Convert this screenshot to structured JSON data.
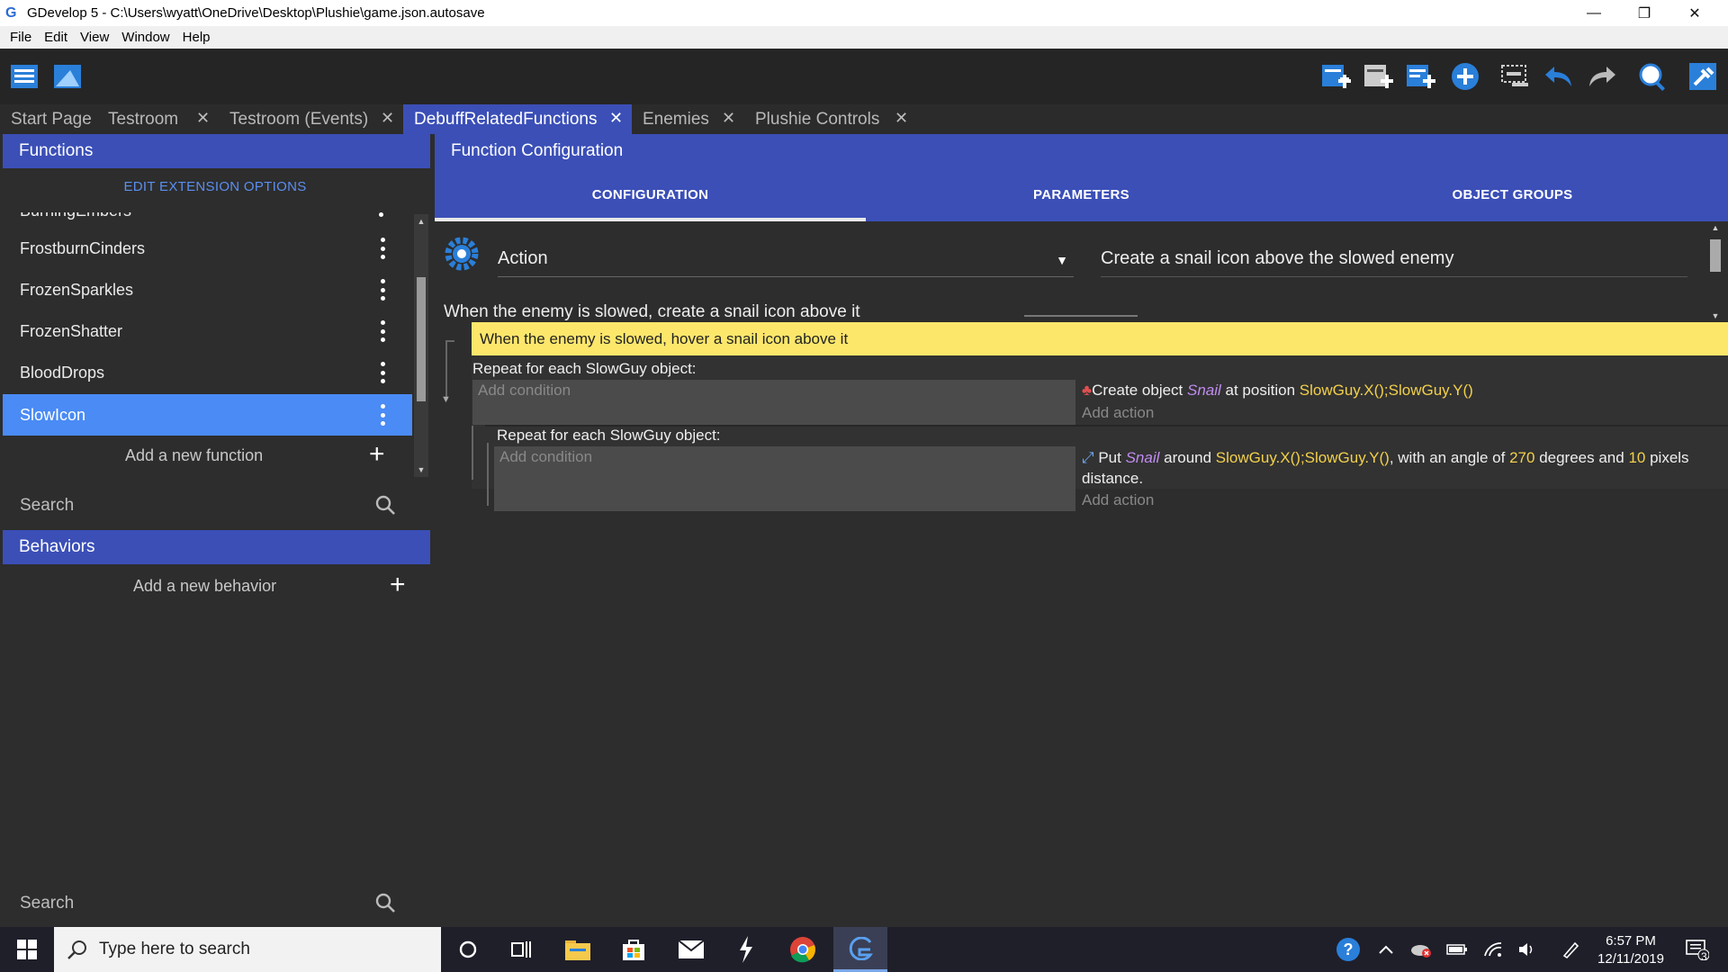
{
  "window": {
    "title": "GDevelop 5 - C:\\Users\\wyatt\\OneDrive\\Desktop\\Plushie\\game.json.autosave",
    "controls": {
      "minimize": "—",
      "restore": "❐",
      "close": "✕"
    }
  },
  "menu": [
    "File",
    "Edit",
    "View",
    "Window",
    "Help"
  ],
  "toolbar": {
    "left_icons": [
      "project-manager-icon",
      "scene-preview-icon"
    ],
    "right_icons": [
      "add-event-icon",
      "add-sub-event-icon",
      "add-comment-icon",
      "add-other-icon",
      "delete-selection-icon",
      "undo-icon",
      "redo-icon",
      "search-events-icon",
      "settings-icon"
    ]
  },
  "tabs": [
    {
      "label": "Start Page",
      "closable": false,
      "active": false
    },
    {
      "label": "Testroom",
      "closable": true,
      "active": false
    },
    {
      "label": "Testroom (Events)",
      "closable": true,
      "active": false
    },
    {
      "label": "DebuffRelatedFunctions",
      "closable": true,
      "active": true
    },
    {
      "label": "Enemies",
      "closable": true,
      "active": false
    },
    {
      "label": "Plushie Controls",
      "closable": true,
      "active": false
    }
  ],
  "functions_panel": {
    "header": "Functions",
    "edit_options": "EDIT EXTENSION OPTIONS",
    "partial_item": "BurningEmbers",
    "items": [
      "FrostburnCinders",
      "FrozenSparkles",
      "FrozenShatter",
      "BloodDrops",
      "SlowIcon"
    ],
    "selected": "SlowIcon",
    "add_label": "Add a new function",
    "search_placeholder": "Search"
  },
  "behaviors_panel": {
    "header": "Behaviors",
    "add_label": "Add a new behavior",
    "search_placeholder": "Search"
  },
  "config": {
    "header": "Function Configuration",
    "tabs": [
      "CONFIGURATION",
      "PARAMETERS",
      "OBJECT GROUPS"
    ],
    "active_tab": "CONFIGURATION",
    "function_type": "Action",
    "description": "Create a snail icon above the slowed enemy",
    "sentence_cut": "When the enemy is slowed, create a snail icon above it"
  },
  "events": {
    "comment": "When the enemy is slowed, hover a snail icon above it",
    "event1": {
      "title": "Repeat for each SlowGuy object:",
      "condition_placeholder": "Add condition",
      "action": {
        "prefix": "Create object ",
        "object": "Snail",
        "mid": " at position ",
        "expr": "SlowGuy.X();SlowGuy.Y()"
      },
      "add_action": "Add action"
    },
    "event2": {
      "title": "Repeat for each SlowGuy object:",
      "condition_placeholder": "Add condition",
      "action": {
        "prefix": "Put ",
        "object": "Snail",
        "mid1": " around ",
        "expr1": "SlowGuy.X();SlowGuy.Y()",
        "mid2": ", with an angle of ",
        "angle": "270",
        "mid3": " degrees and ",
        "distance": "10",
        "suffix": " pixels distance."
      },
      "add_action": "Add action"
    }
  },
  "taskbar": {
    "search_placeholder": "Type here to search",
    "time": "6:57 PM",
    "date": "12/11/2019",
    "notification_count": "3"
  }
}
